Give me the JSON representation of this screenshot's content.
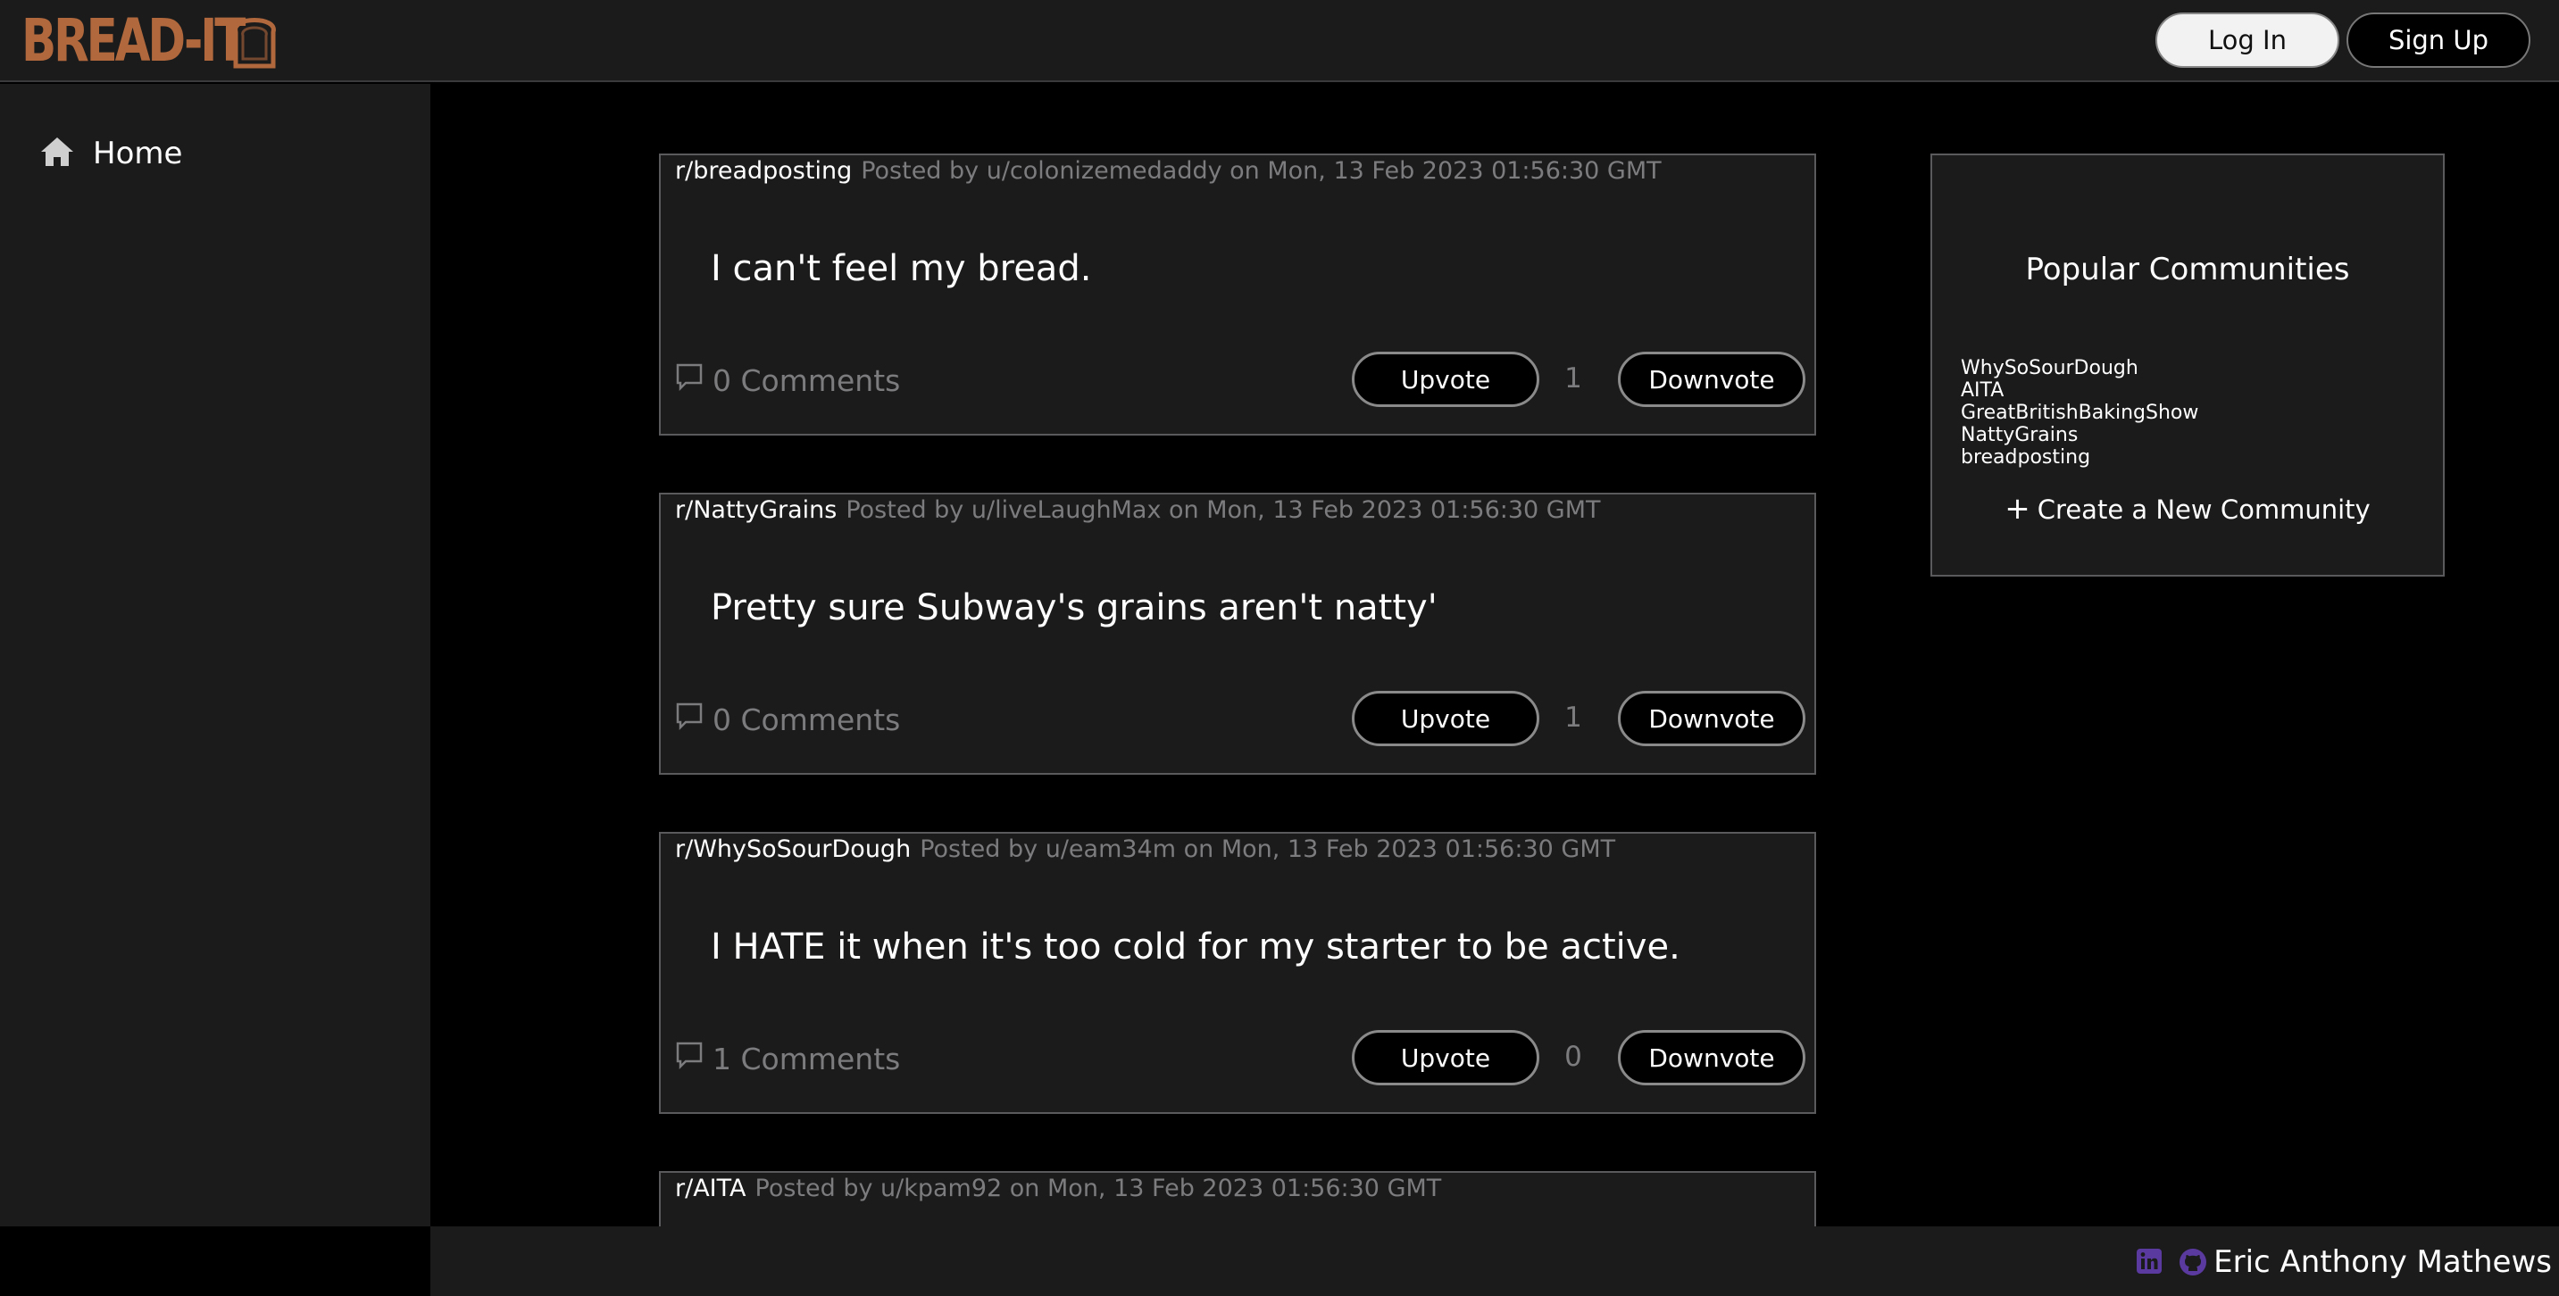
{
  "header": {
    "logo_text": "BREAD-IT",
    "login_label": "Log In",
    "signup_label": "Sign Up",
    "brand_color": "#b0683c"
  },
  "sidebar": {
    "items": [
      {
        "label": "Home",
        "icon": "home-icon"
      }
    ]
  },
  "posts": [
    {
      "subreddit": "r/breadposting",
      "meta": "Posted by u/colonizemedaddy on Mon, 13 Feb 2023 01:56:30 GMT",
      "title": "I can't feel my bread.",
      "comments": "0 Comments",
      "upvote_label": "Upvote",
      "votes": "1",
      "downvote_label": "Downvote"
    },
    {
      "subreddit": "r/NattyGrains",
      "meta": "Posted by u/liveLaughMax on Mon, 13 Feb 2023 01:56:30 GMT",
      "title": "Pretty sure Subway's grains aren't natty'",
      "comments": "0 Comments",
      "upvote_label": "Upvote",
      "votes": "1",
      "downvote_label": "Downvote"
    },
    {
      "subreddit": "r/WhySoSourDough",
      "meta": "Posted by u/eam34m on Mon, 13 Feb 2023 01:56:30 GMT",
      "title": "I HATE it when it's too cold for my starter to be active.",
      "comments": "1 Comments",
      "upvote_label": "Upvote",
      "votes": "0",
      "downvote_label": "Downvote"
    },
    {
      "subreddit": "r/AITA",
      "meta": "Posted by u/kpam92 on Mon, 13 Feb 2023 01:56:30 GMT"
    }
  ],
  "popular": {
    "title": "Popular Communities",
    "communities": [
      "WhySoSourDough",
      "AITA",
      "GreatBritishBakingShow",
      "NattyGrains",
      "breadposting"
    ],
    "create_label": "Create a New Community"
  },
  "footer": {
    "author": "Eric Anthony Mathews",
    "icons": [
      "linkedin-icon",
      "github-icon"
    ],
    "icon_color": "#5b3aa0"
  }
}
